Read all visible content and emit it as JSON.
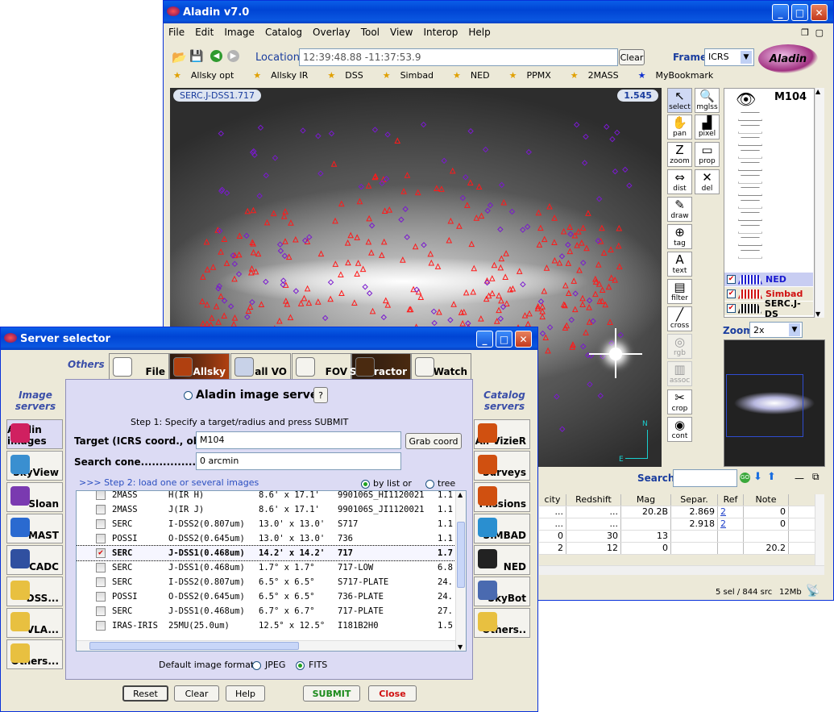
{
  "aladin": {
    "title": "Aladin v7.0",
    "menu": [
      "File",
      "Edit",
      "Image",
      "Catalog",
      "Overlay",
      "Tool",
      "View",
      "Interop",
      "Help"
    ],
    "location_label": "Location",
    "location_value": "12:39:48.88 -11:37:53.9",
    "clear_label": "Clear",
    "frame_label": "Frame",
    "frame_value": "ICRS",
    "logo_text": "Aladin",
    "bookmarks": [
      "Allsky opt",
      "Allsky IR",
      "DSS",
      "Simbad",
      "NED",
      "PPMX",
      "2MASS",
      "MyBookmark"
    ],
    "image_label": "SERC.J-DSS1.717",
    "zoom_badge": "1.545",
    "tools": [
      {
        "label": "select",
        "glyph": "↖"
      },
      {
        "label": "mglss",
        "glyph": "🔍"
      },
      {
        "label": "pan",
        "glyph": "✋"
      },
      {
        "label": "pixel",
        "glyph": "▟"
      },
      {
        "label": "zoom",
        "glyph": "Z"
      },
      {
        "label": "prop",
        "glyph": "▭"
      },
      {
        "label": "dist",
        "glyph": "⇔"
      },
      {
        "label": "del",
        "glyph": "✕"
      },
      {
        "label": "draw",
        "glyph": "✎"
      },
      {
        "label": "tag",
        "glyph": "⊕"
      },
      {
        "label": "text",
        "glyph": "A"
      },
      {
        "label": "filter",
        "glyph": "▤"
      },
      {
        "label": "cross",
        "glyph": "╱"
      },
      {
        "label": "rgb",
        "glyph": "◎"
      },
      {
        "label": "assoc",
        "glyph": "▥"
      },
      {
        "label": "crop",
        "glyph": "✂"
      },
      {
        "label": "cont",
        "glyph": "◉"
      }
    ],
    "stack_title": "M104",
    "planes": [
      {
        "name": "NED",
        "color": "#1a1acf",
        "checked": true
      },
      {
        "name": "Simbad",
        "color": "#d01010",
        "checked": true
      },
      {
        "name": "SERC.J-DS",
        "color": "#000000",
        "checked": true
      }
    ],
    "zoom_label": "Zoom",
    "zoom_value": "2x",
    "search_label": "Search",
    "table": {
      "headers": [
        "city",
        "Redshift",
        "Mag",
        "Separ.",
        "Ref",
        "Note"
      ],
      "rows": [
        [
          "...",
          "...",
          "20.2B",
          "2.869",
          "2",
          "0"
        ],
        [
          "...",
          "...",
          "",
          "2.918",
          "2",
          "0"
        ],
        [
          "0",
          "30",
          "13",
          "",
          "",
          ""
        ],
        [
          "2",
          "12",
          "0",
          "",
          "",
          "20.2"
        ]
      ]
    },
    "status_sel": "5 sel / 844 src",
    "status_mem": "12Mb"
  },
  "selector": {
    "title": "Server selector",
    "tabs": [
      "File",
      "Allsky",
      "all VO",
      "FOV",
      "Sextractor",
      "Watch"
    ],
    "others_label": "Others",
    "image_servers_label": "Image servers",
    "catalog_servers_label": "Catalog servers",
    "left_servers": [
      "Aladin images",
      "SkyView",
      "Sloan",
      "MAST",
      "CADC",
      "DSS...",
      "VLA...",
      "Others..."
    ],
    "right_servers": [
      "All VizieR",
      "Surveys",
      "Missions",
      "SIMBAD",
      "NED",
      "SkyBot",
      "Others.."
    ],
    "panel_title": "Aladin image server",
    "help_button": "?",
    "step1": "Step 1: Specify a target/radius and press SUBMIT",
    "target_label": "Target (ICRS coord., obj.i...",
    "target_value": "M104",
    "grab_label": "Grab coord",
    "cone_label": "Search cone.......................",
    "cone_value": "0 arcmin",
    "step2": ">>> Step 2: load one or several images",
    "by_list": "by list or",
    "tree": "tree",
    "rows": [
      {
        "survey": "2MASS",
        "band": "H(IR H)",
        "size": "8.6' x 17.1'",
        "plate": "990106S_HI1120021",
        "extra": "1.1",
        "checked": false,
        "bold": false
      },
      {
        "survey": "2MASS",
        "band": "J(IR J)",
        "size": "8.6' x 17.1'",
        "plate": "990106S_JI1120021",
        "extra": "1.1",
        "checked": false,
        "bold": false
      },
      {
        "survey": "SERC",
        "band": "I-DSS2(0.807um)",
        "size": "13.0' x 13.0'",
        "plate": "S717",
        "extra": "1.1",
        "checked": false,
        "bold": false
      },
      {
        "survey": "POSSI",
        "band": "O-DSS2(0.645um)",
        "size": "13.0' x 13.0'",
        "plate": "736",
        "extra": "1.1",
        "checked": false,
        "bold": false
      },
      {
        "survey": "SERC",
        "band": "J-DSS1(0.468um)",
        "size": "14.2' x 14.2'",
        "plate": "717",
        "extra": "1.7",
        "checked": true,
        "bold": true
      },
      {
        "survey": "SERC",
        "band": "J-DSS1(0.468um)",
        "size": "1.7° x 1.7°",
        "plate": "717-LOW",
        "extra": "6.8",
        "checked": false,
        "bold": false
      },
      {
        "survey": "SERC",
        "band": "I-DSS2(0.807um)",
        "size": "6.5° x 6.5°",
        "plate": "S717-PLATE",
        "extra": "24.",
        "checked": false,
        "bold": false
      },
      {
        "survey": "POSSI",
        "band": "O-DSS2(0.645um)",
        "size": "6.5° x 6.5°",
        "plate": "736-PLATE",
        "extra": "24.",
        "checked": false,
        "bold": false
      },
      {
        "survey": "SERC",
        "band": "J-DSS1(0.468um)",
        "size": "6.7° x 6.7°",
        "plate": "717-PLATE",
        "extra": "27.",
        "checked": false,
        "bold": false
      },
      {
        "survey": "IRAS-IRIS",
        "band": "25MU(25.0um)",
        "size": "12.5° x 12.5°",
        "plate": "I181B2H0",
        "extra": "1.5",
        "checked": false,
        "bold": false
      }
    ],
    "format_label": "Default image format:",
    "format_jpeg": "JPEG",
    "format_fits": "FITS",
    "buttons": {
      "reset": "Reset",
      "clear": "Clear",
      "help": "Help",
      "submit": "SUBMIT",
      "close": "Close"
    }
  }
}
